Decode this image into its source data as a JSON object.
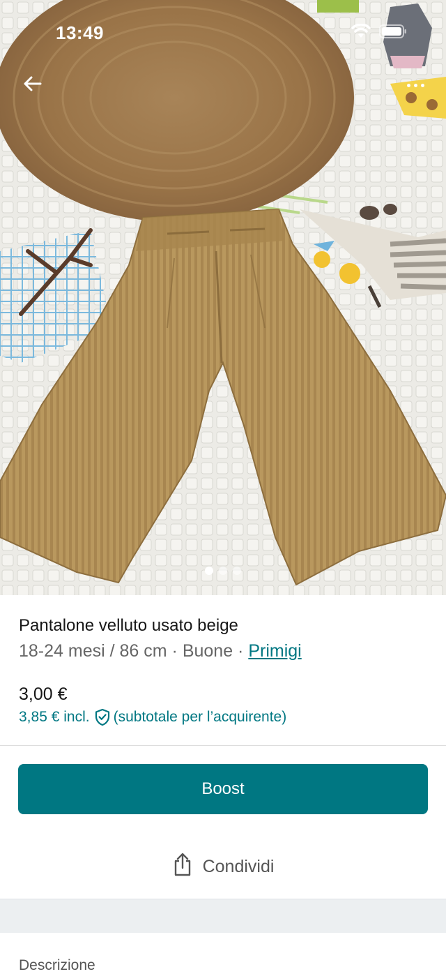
{
  "status_bar": {
    "time": "13:49"
  },
  "photo": {
    "page_count": 3,
    "current_page": 1
  },
  "item": {
    "title": "Pantalone velluto usato beige",
    "size": "18-24 mesi / 86 cm",
    "separator": " · ",
    "condition": "Buone",
    "brand": "Primigi",
    "price": "3,00 €",
    "price_incl": "3,85 € incl.",
    "price_incl_note": "(subtotale per l’acquirente)"
  },
  "actions": {
    "boost_label": "Boost",
    "share_label": "Condividi"
  },
  "next_section": {
    "label": "Descrizione"
  },
  "colors": {
    "accent": "#007782",
    "text_primary": "#171717",
    "text_secondary": "#666666"
  }
}
